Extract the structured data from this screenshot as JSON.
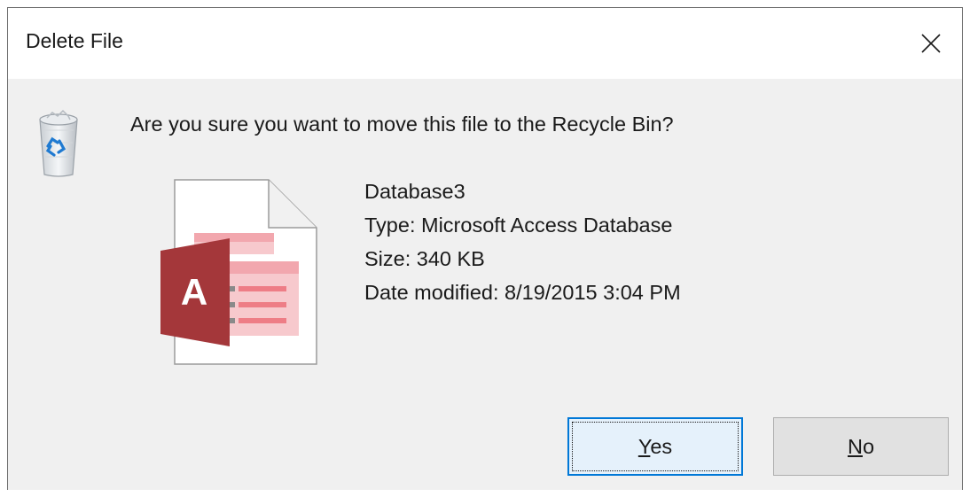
{
  "window": {
    "title": "Delete File",
    "close_icon": "close-icon"
  },
  "message": "Are you sure you want to move this file to the Recycle Bin?",
  "icons": {
    "dialog_icon": "recycle-bin-icon",
    "file_icon": "microsoft-access-file-icon",
    "file_icon_letter": "A"
  },
  "file": {
    "name": "Database3",
    "type": "Type: Microsoft Access Database",
    "size": "Size: 340 KB",
    "date_modified": "Date modified: 8/19/2015 3:04 PM"
  },
  "buttons": {
    "yes": {
      "mnemonic": "Y",
      "rest": "es"
    },
    "no": {
      "mnemonic": "N",
      "rest": "o"
    }
  },
  "colors": {
    "access_red": "#a4373a",
    "access_pink": "#f2b6bc",
    "focus_blue": "#0078d7",
    "dialog_bg": "#f0f0f0"
  }
}
